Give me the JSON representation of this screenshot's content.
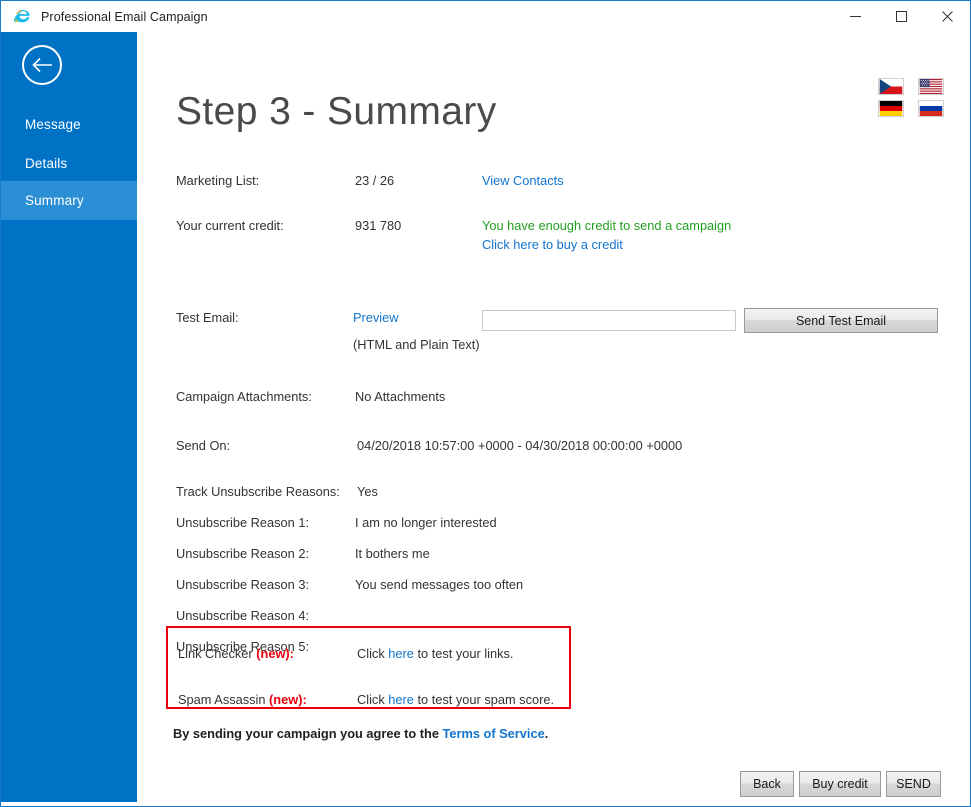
{
  "window": {
    "title": "Professional Email Campaign",
    "app_icon": "internet-explorer-icon",
    "minimize_label": "Minimize",
    "maximize_label": "Maximize",
    "close_label": "Close",
    "accent_color": "#0072c6",
    "sidebar_active_color": "#2a8fd4"
  },
  "sidebar": {
    "back_label": "Back",
    "items": [
      {
        "label": "Message",
        "active": false
      },
      {
        "label": "Details",
        "active": false
      },
      {
        "label": "Summary",
        "active": true
      }
    ]
  },
  "languages": [
    {
      "name": "czech-flag",
      "code": "cs"
    },
    {
      "name": "usa-flag",
      "code": "en"
    },
    {
      "name": "german-flag",
      "code": "de"
    },
    {
      "name": "russian-flag",
      "code": "ru"
    }
  ],
  "main": {
    "title": "Step 3 - Summary",
    "marketing_list": {
      "label": "Marketing List:",
      "value": "23 / 26",
      "link": "View Contacts"
    },
    "credit": {
      "label": "Your current credit:",
      "value": "931 780",
      "status": "You have enough credit to send a campaign",
      "buy_link": "Click here to buy a credit"
    },
    "test_email": {
      "label": "Test Email:",
      "preview_link": "Preview",
      "note": "(HTML and Plain Text)",
      "input_value": "",
      "input_placeholder": "",
      "send_button": "Send Test Email"
    },
    "attachments": {
      "label": "Campaign Attachments:",
      "value": "No Attachments"
    },
    "send_on": {
      "label": "Send On:",
      "value": "04/20/2018 10:57:00 +0000 - 04/30/2018 00:00:00 +0000"
    },
    "track_unsubscribe": {
      "label": "Track Unsubscribe Reasons:",
      "value": "Yes"
    },
    "unsubscribe_reasons": [
      {
        "label": "Unsubscribe Reason 1:",
        "value": "I am no longer interested"
      },
      {
        "label": "Unsubscribe Reason 2:",
        "value": "It bothers me"
      },
      {
        "label": "Unsubscribe Reason 3:",
        "value": "You send messages too often"
      },
      {
        "label": "Unsubscribe Reason 4:",
        "value": ""
      },
      {
        "label": "Unsubscribe Reason 5:",
        "value": ""
      }
    ],
    "highlight_box": {
      "border_color": "#e8000d",
      "link_checker": {
        "label": "Link Checker ",
        "new_tag": "(new):",
        "text_before": "Click ",
        "link": "here",
        "text_after": " to test your links."
      },
      "spam_assassin": {
        "label": "Spam Assassin ",
        "new_tag": "(new):",
        "text_before": "Click ",
        "link": "here",
        "text_after": " to test your spam score."
      }
    },
    "terms": {
      "text_before": "By sending your campaign you agree to the ",
      "link": "Terms of Service",
      "text_after": "."
    },
    "footer_buttons": {
      "back": "Back",
      "buy_credit": "Buy credit",
      "send": "SEND"
    }
  }
}
